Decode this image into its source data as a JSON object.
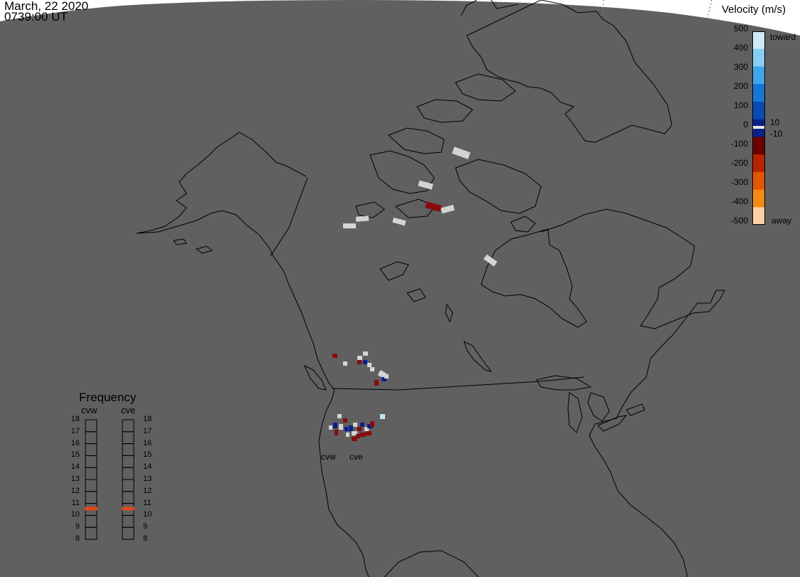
{
  "header": {
    "date": "March, 22 2020",
    "time": "0739:00 UT"
  },
  "velocity_scale": {
    "title": "Velocity (m/s)",
    "ticks": [
      "500",
      "400",
      "300",
      "200",
      "100",
      "0",
      "-100",
      "-200",
      "-300",
      "-400",
      "-500"
    ],
    "inner_ticks": {
      "positive": "10",
      "negative": "-10"
    },
    "toward_label": "toward",
    "away_label": "away",
    "colors": [
      "#cfe9fb",
      "#87cdf4",
      "#3fa6ea",
      "#1576d6",
      "#0a4ab3",
      "#08238a",
      "#6b0000",
      "#b82400",
      "#e25600",
      "#f68a14",
      "#fbd0a6"
    ]
  },
  "frequency_panel": {
    "title": "Frequency",
    "radars": [
      {
        "name": "cvw",
        "frequency_mhz": 10.6
      },
      {
        "name": "cve",
        "frequency_mhz": 10.6
      }
    ],
    "ticks": [
      "18",
      "17",
      "16",
      "15",
      "14",
      "13",
      "12",
      "11",
      "10",
      "9",
      "8"
    ],
    "marker_color": "#e0481b"
  },
  "map": {
    "radar_labels": [
      "cvw",
      "cve"
    ],
    "earth_color": "#606060",
    "space_color": "#ffffff",
    "daylight_color": "#fffff0",
    "echo_colors": {
      "gray": "#d4d4d4",
      "red": "#8b0a0a",
      "blue": "#0c1f8c",
      "lightblue": "#bfe6fa"
    }
  }
}
